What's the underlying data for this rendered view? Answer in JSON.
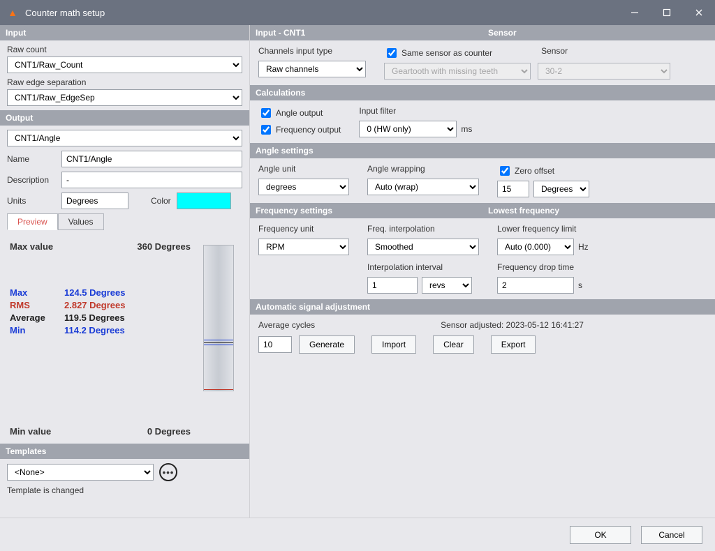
{
  "window": {
    "title": "Counter math setup"
  },
  "input": {
    "header": "Input",
    "raw_count_label": "Raw count",
    "raw_count_value": "CNT1/Raw_Count",
    "raw_edge_label": "Raw edge separation",
    "raw_edge_value": "CNT1/Raw_EdgeSep"
  },
  "output": {
    "header": "Output",
    "channel_value": "CNT1/Angle",
    "name_label": "Name",
    "name_value": "CNT1/Angle",
    "desc_label": "Description",
    "desc_value": "-",
    "units_label": "Units",
    "units_value": "Degrees",
    "color_label": "Color",
    "color_hex": "#00ffff",
    "tabs": {
      "preview": "Preview",
      "values": "Values"
    },
    "preview": {
      "max_label": "Max value",
      "max_value": "360 Degrees",
      "min_label": "Min value",
      "min_value": "0 Degrees",
      "stats": {
        "max_label": "Max",
        "max_val": "124.5 Degrees",
        "rms_label": "RMS",
        "rms_val": "2.827 Degrees",
        "avg_label": "Average",
        "avg_val": "119.5 Degrees",
        "min_label": "Min",
        "min_val": "114.2 Degrees"
      }
    }
  },
  "templates": {
    "header": "Templates",
    "value": "<None>",
    "status": "Template is changed"
  },
  "right": {
    "input_cnt": {
      "header": "Input - CNT1",
      "channels_type_label": "Channels input type",
      "channels_type_value": "Raw channels"
    },
    "sensor": {
      "header": "Sensor",
      "same_label": "Same sensor as counter",
      "sensor_label": "Sensor",
      "sensor_type": "Geartooth with missing teeth",
      "sensor_variant": "30-2"
    },
    "calc": {
      "header": "Calculations",
      "angle_out": "Angle output",
      "freq_out": "Frequency output",
      "input_filter_label": "Input filter",
      "input_filter_value": "0 (HW only)",
      "ms": "ms"
    },
    "angle": {
      "header": "Angle settings",
      "unit_label": "Angle unit",
      "unit_value": "degrees",
      "wrap_label": "Angle wrapping",
      "wrap_value": "Auto (wrap)",
      "zero_label": "Zero offset",
      "zero_value": "15",
      "zero_unit": "Degrees"
    },
    "freq": {
      "header": "Frequency settings",
      "lowest_header": "Lowest frequency",
      "unit_label": "Frequency unit",
      "unit_value": "RPM",
      "interp_label": "Freq. interpolation",
      "interp_value": "Smoothed",
      "interval_label": "Interpolation interval",
      "interval_value": "1",
      "interval_unit": "revs",
      "lower_label": "Lower frequency limit",
      "lower_value": "Auto (0.000)",
      "hz": "Hz",
      "drop_label": "Frequency drop time",
      "drop_value": "2",
      "s": "s"
    },
    "auto": {
      "header": "Automatic signal adjustment",
      "avg_label": "Average cycles",
      "avg_value": "10",
      "generate": "Generate",
      "import": "Import",
      "clear": "Clear",
      "export": "Export",
      "adjusted_label": "Sensor adjusted: 2023-05-12 16:41:27"
    }
  },
  "footer": {
    "ok": "OK",
    "cancel": "Cancel"
  }
}
